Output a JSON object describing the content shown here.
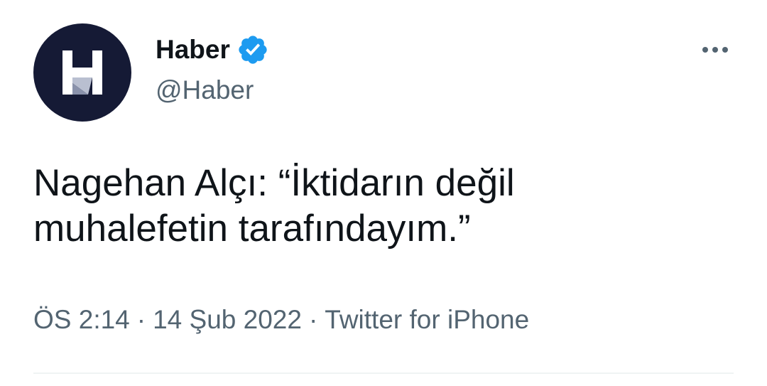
{
  "tweet": {
    "author": {
      "display_name": "Haber",
      "handle": "@Haber",
      "verified": true,
      "avatar_icon": "haber-logo-icon"
    },
    "more_icon": "more-dots-icon",
    "text": "Nagehan Alçı: “İktidarın değil\nmuhalefetin tarafındayım.”",
    "meta": {
      "time": "ÖS 2:14",
      "separator": "·",
      "date": "14 Şub 2022",
      "source": "Twitter for iPhone"
    }
  },
  "colors": {
    "avatar_bg": "#151a35",
    "verified_blue": "#1d9bf0",
    "primary_text": "#0f1419",
    "secondary_text": "#536471",
    "divider": "#eff3f4"
  }
}
